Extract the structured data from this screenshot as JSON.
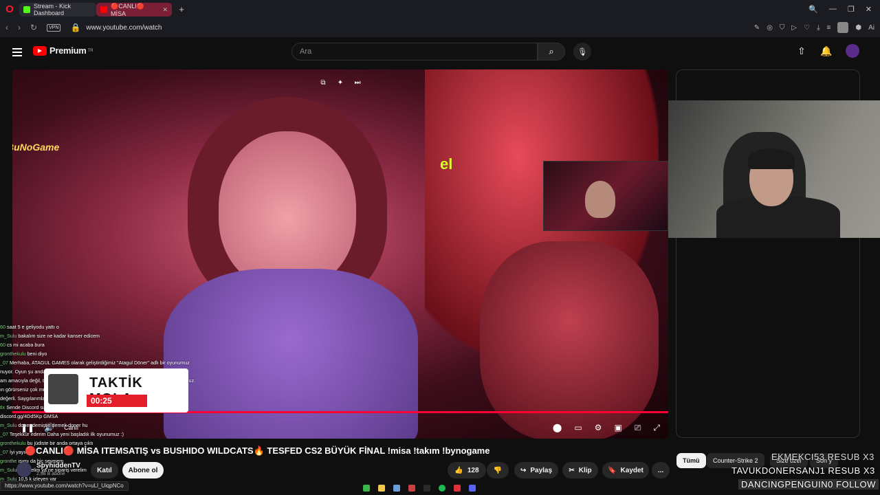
{
  "browser": {
    "tabs": [
      {
        "label": "Stream - Kick Dashboard",
        "favicon_color": "#53fc18"
      },
      {
        "label": "🔴CANLI🔴 MİSA",
        "favicon_color": "#ff0000",
        "active": true
      }
    ],
    "url": "www.youtube.com/watch",
    "vpn_label": "VPN",
    "new_tab": "+",
    "ai_label": "Ai"
  },
  "youtube": {
    "brand": "Premium",
    "region": "TR",
    "search_placeholder": "Ara"
  },
  "video": {
    "overlay_logo": "BuNoGame",
    "brand_text": "el",
    "live_label": "Canlı",
    "progress_percent": 100,
    "break_banner": {
      "title": "TAKTİK MOLA",
      "timer": "00:25"
    },
    "chat": [
      {
        "user": "60",
        "text": "saat 5 e geliyodu yattı o"
      },
      {
        "user": "m_Sulu",
        "text": "bakalım size ne kadar kanser edicem"
      },
      {
        "user": "60",
        "text": "cs mi acaba bura"
      },
      {
        "user": "gronthekulu",
        "text": "beni diyo"
      },
      {
        "user": "_07",
        "text": "Merhaba, ATAGUL GAMES olarak geliştirdiğimiz \"Atagul Döner\" adlı bir oyunumuz"
      },
      {
        "user": "",
        "text": "nuyor. Oyun şu anda erken erişim aşamasında ve geri bildirimlerinizi alıyor."
      },
      {
        "user": "",
        "text": "am amacıyla değil, tamamen oyunu denemeniz bizi mutlu eder. Oyunu destekleyorsunuz."
      },
      {
        "user": "",
        "text": "ın görürseniz çok mutlu oluruz. Yorumlarınızı bekliyoruz görüşlerinizi yazım için"
      },
      {
        "user": "",
        "text": "değerli. Saygılarımla, ATAGUL GAMES"
      },
      {
        "user": "tlx",
        "text": "Sende Discord sunucumuza katılmak için sunucumuz klima"
      },
      {
        "user": "",
        "text": "discord.gg/4Dd5Kp GMSA"
      },
      {
        "user": "m_Sulu",
        "text": "doner demiştin demek doner hu"
      },
      {
        "user": "_07",
        "text": "Teşekkür ederim Daha yeni başladık ilk oyunumuz :)"
      },
      {
        "user": "gronthekulu",
        "text": "bu jüdiste bir anda ortaya çıktı"
      },
      {
        "user": "_07",
        "text": "İyi yayınlar."
      },
      {
        "user": "gronthe",
        "text": "ışımı da hiç sevmem"
      },
      {
        "user": "m_Sulu",
        "text": "ne yiyelim ya ne sipariş verelim"
      },
      {
        "user": "m_Sulu",
        "text": "10,5 k izleyen var"
      }
    ]
  },
  "title": "🔴CANLI🔴 MİSA ITEMSATIŞ vs BUSHIDO WILDCATS🔥 TESFED CS2 BÜYÜK FİNAL !misa !takım !bynogame",
  "channel": {
    "name": "SpyhiddenTV",
    "subs": "2,98 B abone"
  },
  "actions": {
    "join": "Katıl",
    "subscribe": "Abone ol",
    "likes": "128",
    "share": "Paylaş",
    "clip": "Klip",
    "save": "Kaydet",
    "more": "..."
  },
  "chips": [
    "Tümü",
    "Counter-Strike 2",
    "Size özel",
    "Son y"
  ],
  "alerts": [
    "EKMEKCI53 RESUB X3",
    "TAVUKDONERSANJ1 RESUB X3",
    "DANCINGPENGUIN0 FOLLOW"
  ],
  "status_url": "https://www.youtube.com/watch?v=uLl_UiqpNCo"
}
